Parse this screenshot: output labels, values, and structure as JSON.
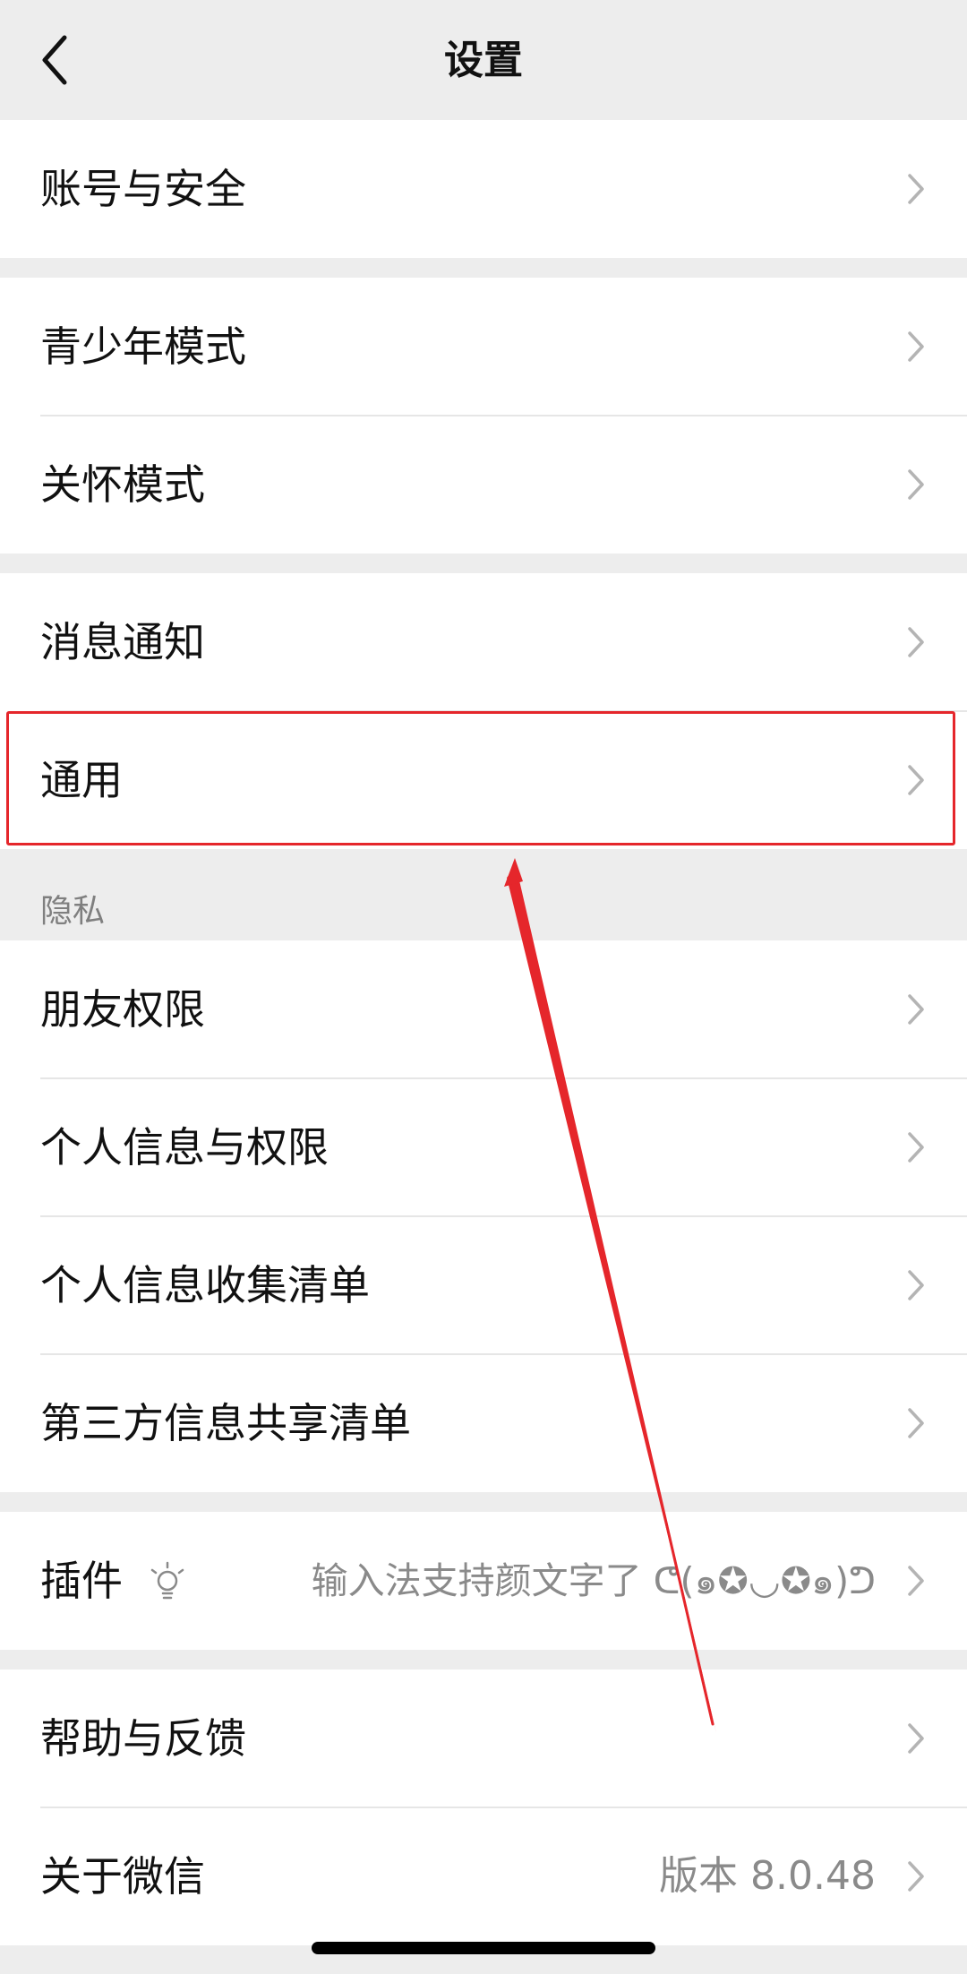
{
  "nav": {
    "title": "设置"
  },
  "items": {
    "account_security": {
      "label": "账号与安全"
    },
    "teen_mode": {
      "label": "青少年模式"
    },
    "care_mode": {
      "label": "关怀模式"
    },
    "notifications": {
      "label": "消息通知"
    },
    "general": {
      "label": "通用"
    },
    "friend_permissions": {
      "label": "朋友权限"
    },
    "personal_info_permissions": {
      "label": "个人信息与权限"
    },
    "personal_info_collection": {
      "label": "个人信息收集清单"
    },
    "third_party_sharing": {
      "label": "第三方信息共享清单"
    },
    "plugins": {
      "label": "插件",
      "value": "输入法支持颜文字了 ᕦ(๑✪◡✪๑)ᕤ"
    },
    "help_feedback": {
      "label": "帮助与反馈"
    },
    "about": {
      "label": "关于微信",
      "value": "版本 8.0.48"
    }
  },
  "sections": {
    "privacy": "隐私"
  },
  "colors": {
    "background": "#ededed",
    "cell": "#ffffff",
    "text": "#111111",
    "secondary_text": "#8a8a8a",
    "annotation": "#e5262b"
  },
  "icons": [
    "back-icon",
    "chevron-right-icon",
    "lightbulb-icon"
  ]
}
